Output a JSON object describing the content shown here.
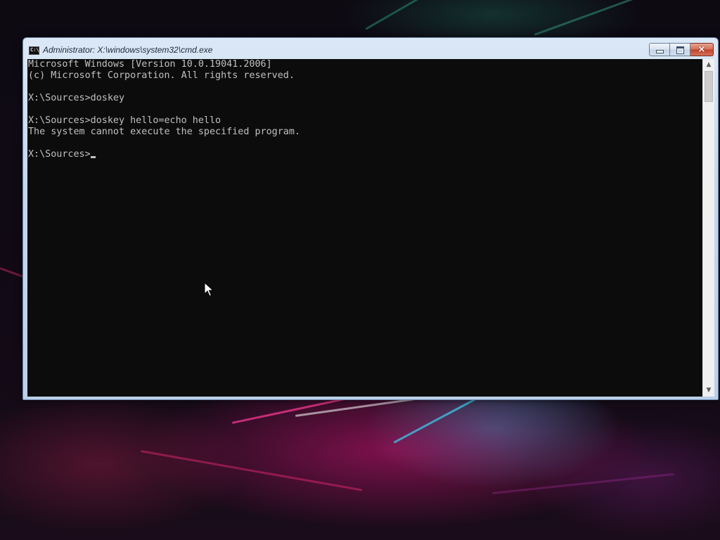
{
  "window": {
    "title": "Administrator: X:\\windows\\system32\\cmd.exe",
    "icon_label": "C:\\"
  },
  "caption_buttons": {
    "minimize": "minimize-icon",
    "maximize": "maximize-icon",
    "close": "×"
  },
  "console": {
    "lines": [
      "Microsoft Windows [Version 10.0.19041.2006]",
      "(c) Microsoft Corporation. All rights reserved.",
      "",
      "X:\\Sources>doskey",
      "",
      "X:\\Sources>doskey hello=echo hello",
      "The system cannot execute the specified program.",
      "",
      "X:\\Sources>"
    ],
    "text_color": "#c0c0c0",
    "background_color": "#0c0c0c"
  },
  "scrollbar": {
    "up_arrow": "▲",
    "down_arrow": "▼"
  },
  "colors": {
    "title_bar": "#c4d7ec",
    "close_button": "#c14129"
  }
}
